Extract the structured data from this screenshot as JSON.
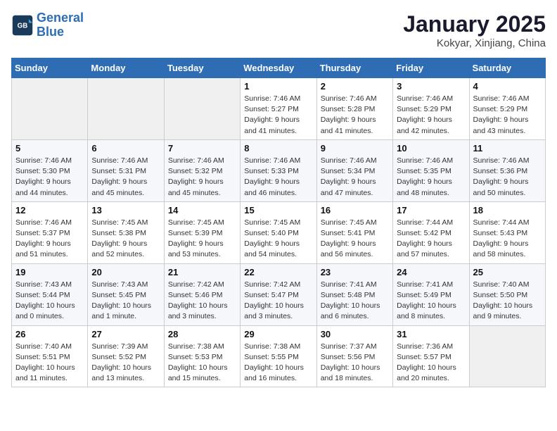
{
  "header": {
    "logo_line1": "General",
    "logo_line2": "Blue",
    "month": "January 2025",
    "location": "Kokyar, Xinjiang, China"
  },
  "weekdays": [
    "Sunday",
    "Monday",
    "Tuesday",
    "Wednesday",
    "Thursday",
    "Friday",
    "Saturday"
  ],
  "weeks": [
    [
      {
        "day": "",
        "info": ""
      },
      {
        "day": "",
        "info": ""
      },
      {
        "day": "",
        "info": ""
      },
      {
        "day": "1",
        "info": "Sunrise: 7:46 AM\nSunset: 5:27 PM\nDaylight: 9 hours and 41 minutes."
      },
      {
        "day": "2",
        "info": "Sunrise: 7:46 AM\nSunset: 5:28 PM\nDaylight: 9 hours and 41 minutes."
      },
      {
        "day": "3",
        "info": "Sunrise: 7:46 AM\nSunset: 5:29 PM\nDaylight: 9 hours and 42 minutes."
      },
      {
        "day": "4",
        "info": "Sunrise: 7:46 AM\nSunset: 5:29 PM\nDaylight: 9 hours and 43 minutes."
      }
    ],
    [
      {
        "day": "5",
        "info": "Sunrise: 7:46 AM\nSunset: 5:30 PM\nDaylight: 9 hours and 44 minutes."
      },
      {
        "day": "6",
        "info": "Sunrise: 7:46 AM\nSunset: 5:31 PM\nDaylight: 9 hours and 45 minutes."
      },
      {
        "day": "7",
        "info": "Sunrise: 7:46 AM\nSunset: 5:32 PM\nDaylight: 9 hours and 45 minutes."
      },
      {
        "day": "8",
        "info": "Sunrise: 7:46 AM\nSunset: 5:33 PM\nDaylight: 9 hours and 46 minutes."
      },
      {
        "day": "9",
        "info": "Sunrise: 7:46 AM\nSunset: 5:34 PM\nDaylight: 9 hours and 47 minutes."
      },
      {
        "day": "10",
        "info": "Sunrise: 7:46 AM\nSunset: 5:35 PM\nDaylight: 9 hours and 48 minutes."
      },
      {
        "day": "11",
        "info": "Sunrise: 7:46 AM\nSunset: 5:36 PM\nDaylight: 9 hours and 50 minutes."
      }
    ],
    [
      {
        "day": "12",
        "info": "Sunrise: 7:46 AM\nSunset: 5:37 PM\nDaylight: 9 hours and 51 minutes."
      },
      {
        "day": "13",
        "info": "Sunrise: 7:45 AM\nSunset: 5:38 PM\nDaylight: 9 hours and 52 minutes."
      },
      {
        "day": "14",
        "info": "Sunrise: 7:45 AM\nSunset: 5:39 PM\nDaylight: 9 hours and 53 minutes."
      },
      {
        "day": "15",
        "info": "Sunrise: 7:45 AM\nSunset: 5:40 PM\nDaylight: 9 hours and 54 minutes."
      },
      {
        "day": "16",
        "info": "Sunrise: 7:45 AM\nSunset: 5:41 PM\nDaylight: 9 hours and 56 minutes."
      },
      {
        "day": "17",
        "info": "Sunrise: 7:44 AM\nSunset: 5:42 PM\nDaylight: 9 hours and 57 minutes."
      },
      {
        "day": "18",
        "info": "Sunrise: 7:44 AM\nSunset: 5:43 PM\nDaylight: 9 hours and 58 minutes."
      }
    ],
    [
      {
        "day": "19",
        "info": "Sunrise: 7:43 AM\nSunset: 5:44 PM\nDaylight: 10 hours and 0 minutes."
      },
      {
        "day": "20",
        "info": "Sunrise: 7:43 AM\nSunset: 5:45 PM\nDaylight: 10 hours and 1 minute."
      },
      {
        "day": "21",
        "info": "Sunrise: 7:42 AM\nSunset: 5:46 PM\nDaylight: 10 hours and 3 minutes."
      },
      {
        "day": "22",
        "info": "Sunrise: 7:42 AM\nSunset: 5:47 PM\nDaylight: 10 hours and 3 minutes."
      },
      {
        "day": "23",
        "info": "Sunrise: 7:41 AM\nSunset: 5:48 PM\nDaylight: 10 hours and 6 minutes."
      },
      {
        "day": "24",
        "info": "Sunrise: 7:41 AM\nSunset: 5:49 PM\nDaylight: 10 hours and 8 minutes."
      },
      {
        "day": "25",
        "info": "Sunrise: 7:40 AM\nSunset: 5:50 PM\nDaylight: 10 hours and 9 minutes."
      }
    ],
    [
      {
        "day": "26",
        "info": "Sunrise: 7:40 AM\nSunset: 5:51 PM\nDaylight: 10 hours and 11 minutes."
      },
      {
        "day": "27",
        "info": "Sunrise: 7:39 AM\nSunset: 5:52 PM\nDaylight: 10 hours and 13 minutes."
      },
      {
        "day": "28",
        "info": "Sunrise: 7:38 AM\nSunset: 5:53 PM\nDaylight: 10 hours and 15 minutes."
      },
      {
        "day": "29",
        "info": "Sunrise: 7:38 AM\nSunset: 5:55 PM\nDaylight: 10 hours and 16 minutes."
      },
      {
        "day": "30",
        "info": "Sunrise: 7:37 AM\nSunset: 5:56 PM\nDaylight: 10 hours and 18 minutes."
      },
      {
        "day": "31",
        "info": "Sunrise: 7:36 AM\nSunset: 5:57 PM\nDaylight: 10 hours and 20 minutes."
      },
      {
        "day": "",
        "info": ""
      }
    ]
  ]
}
